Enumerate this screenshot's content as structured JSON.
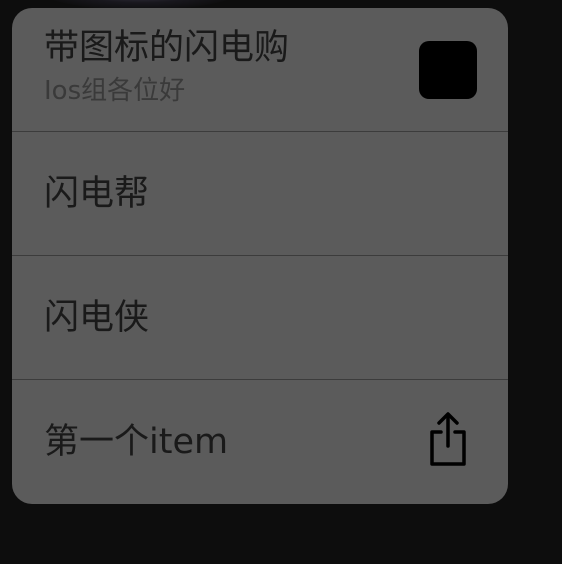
{
  "menu": {
    "items": [
      {
        "title": "带图标的闪电购",
        "subtitle": "Ios组各位好",
        "icon": "square-icon"
      },
      {
        "title": "闪电帮"
      },
      {
        "title": "闪电侠"
      },
      {
        "title": "第一个item",
        "icon": "share-icon"
      }
    ]
  },
  "colors": {
    "background": "#0d0d0d",
    "menu_background": "#5b5b5b",
    "separator": "#3c3c3c",
    "text": "#1a1a1a",
    "subtitle_text": "#3a3a3a"
  }
}
